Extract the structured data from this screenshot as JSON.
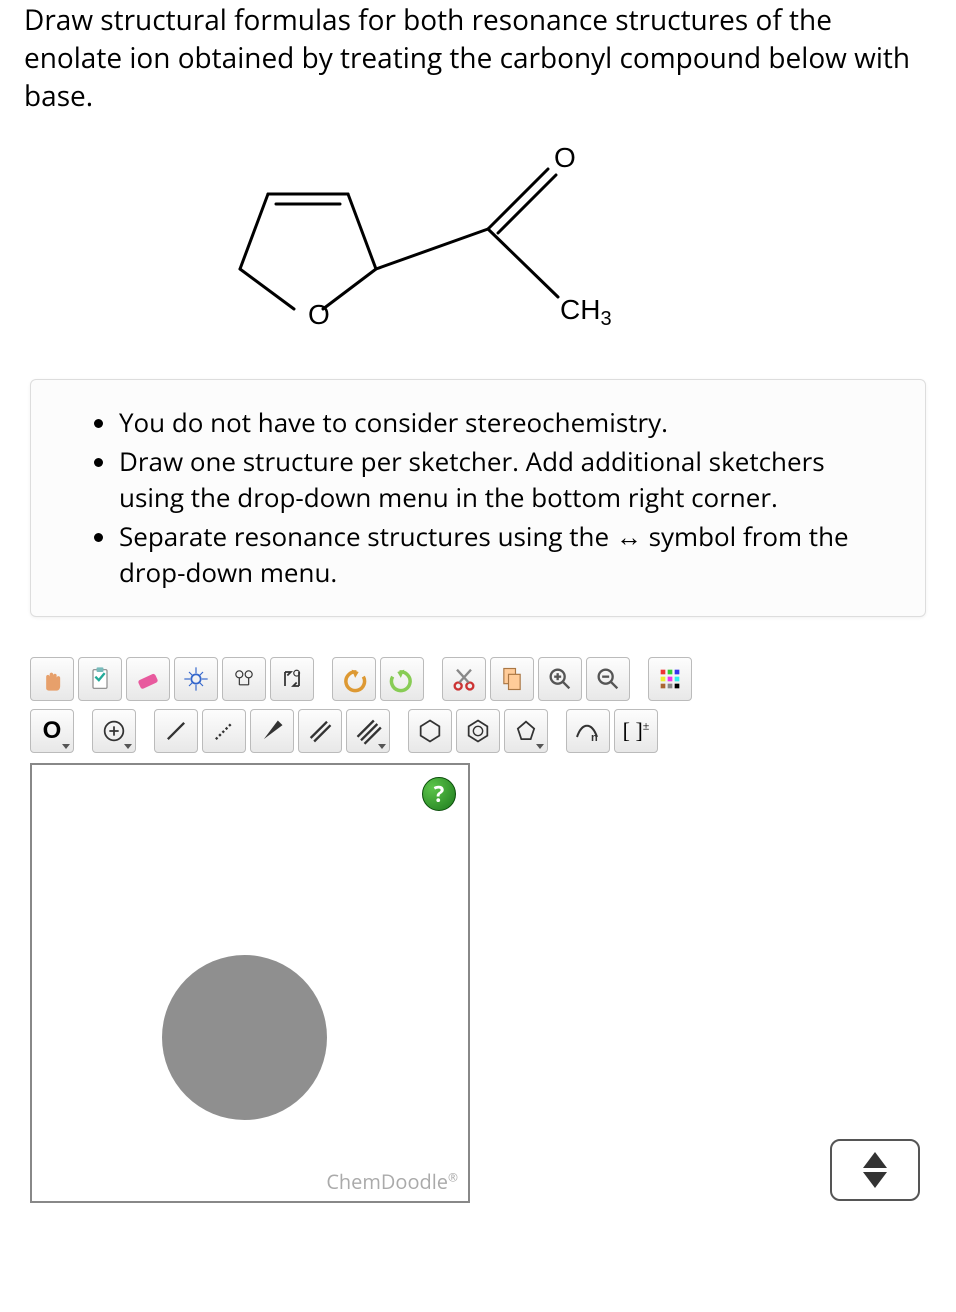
{
  "question": "Draw structural formulas for both resonance structures of the enolate ion obtained by treating the carbonyl compound below with base.",
  "structure_labels": {
    "o1": "O",
    "o2": "O",
    "ch3": "CH3"
  },
  "instructions": [
    "You do not have to consider stereochemistry.",
    "Draw one structure per sketcher. Add additional sketchers using the drop-down menu in the bottom right corner.",
    "Separate resonance structures using the ↔ symbol from the drop-down menu."
  ],
  "toolbar": {
    "element": "O",
    "charge": "⊕",
    "sn": "n",
    "bracket": "[ ]±"
  },
  "canvas": {
    "help": "?",
    "watermark": "ChemDoodle",
    "watermark_r": "®"
  }
}
